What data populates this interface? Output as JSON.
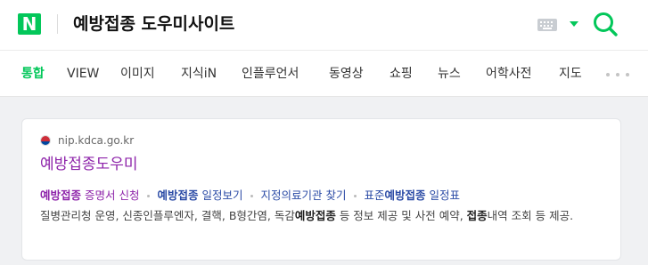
{
  "header": {
    "logo": "N",
    "query": "예방접종 도우미사이트",
    "colors": {
      "brand": "#03c75a"
    }
  },
  "tabs": [
    {
      "label": "통합",
      "active": true
    },
    {
      "label": "VIEW"
    },
    {
      "label": "이미지"
    },
    {
      "label": "지식iN"
    },
    {
      "label": "인플루언서"
    },
    {
      "label": "동영상"
    },
    {
      "label": "쇼핑"
    },
    {
      "label": "뉴스"
    },
    {
      "label": "어학사전"
    },
    {
      "label": "지도"
    }
  ],
  "result": {
    "source_url": "nip.kdca.go.kr",
    "title": "예방접종도우미",
    "sitelinks": [
      {
        "pre": "",
        "bold": "예방접종",
        "post": " 증명서 신청"
      },
      {
        "pre": "",
        "bold": "예방접종",
        "post": " 일정보기"
      },
      {
        "pre": "지정의료기관 찾기",
        "bold": "",
        "post": ""
      },
      {
        "pre": "표준",
        "bold": "예방접종",
        "post": " 일정표"
      }
    ],
    "description": {
      "part1": "질병관리청 운영, 신종인플루엔자, 결핵, B형간염, 독감",
      "bold1": "예방접종",
      "part2": " 등 정보 제공 및 사전 예약, ",
      "bold2": "접종",
      "part3": "내역 조회 등 제공."
    }
  }
}
